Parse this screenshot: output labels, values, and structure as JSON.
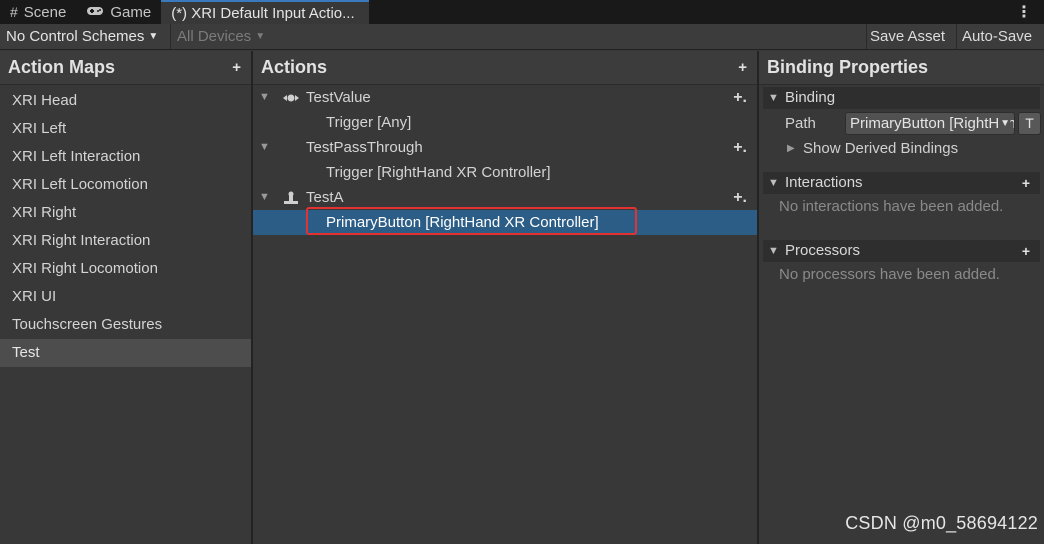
{
  "tabs": [
    {
      "label": "Scene",
      "icon": "grid-icon",
      "active": false
    },
    {
      "label": "Game",
      "icon": "gamepad-icon",
      "active": false
    },
    {
      "label": "(*) XRI Default Input Actio...",
      "icon": "",
      "active": true
    }
  ],
  "toolbar": {
    "control_schemes": "No Control Schemes",
    "devices": "All Devices",
    "save_asset": "Save Asset",
    "auto_save": "Auto-Save"
  },
  "action_maps": {
    "title": "Action Maps",
    "items": [
      "XRI Head",
      "XRI Left",
      "XRI Left Interaction",
      "XRI Left Locomotion",
      "XRI Right",
      "XRI Right Interaction",
      "XRI Right Locomotion",
      "XRI UI",
      "Touchscreen Gestures",
      "Test"
    ],
    "selected_index": 9
  },
  "actions": {
    "title": "Actions",
    "tree": [
      {
        "action": "TestValue",
        "icon": "value-action-icon",
        "binding": "Trigger [Any]"
      },
      {
        "action": "TestPassThrough",
        "icon": "",
        "binding": "Trigger [RightHand XR Controller]"
      },
      {
        "action": "TestA",
        "icon": "button-action-icon",
        "binding": "PrimaryButton [RightHand XR Controller]",
        "selected": true
      }
    ]
  },
  "binding_properties": {
    "title": "Binding Properties",
    "binding_section": "Binding",
    "path_label": "Path",
    "path_value": "PrimaryButton [RightHand XR Controller]",
    "t_button": "T",
    "show_derived": "Show Derived Bindings",
    "interactions_section": "Interactions",
    "interactions_empty": "No interactions have been added.",
    "processors_section": "Processors",
    "processors_empty": "No processors have been added."
  },
  "watermark": "CSDN @m0_58694122",
  "colors": {
    "selection": "#2c5d87",
    "highlight_box": "#e23232",
    "active_tab_accent": "#3a79bb"
  }
}
